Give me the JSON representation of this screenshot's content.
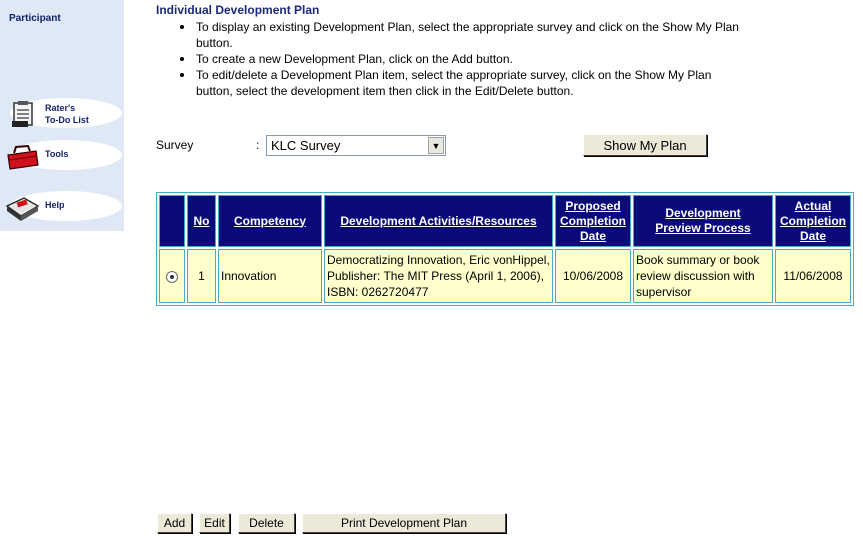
{
  "sidebar": {
    "title": "Participant",
    "items": [
      {
        "label_line1": "Rater's",
        "label_line2": "To-Do List",
        "icon": "rater-todo-icon"
      },
      {
        "label_line1": "Tools",
        "label_line2": "",
        "icon": "toolbox-icon"
      },
      {
        "label_line1": "Help",
        "label_line2": "",
        "icon": "help-icon"
      }
    ]
  },
  "page": {
    "title": "Individual Development Plan",
    "instructions": [
      "To display an existing Development Plan, select the appropriate survey and click on the Show My Plan button.",
      "To create a new Development Plan, click on the Add button.",
      "To edit/delete a Development Plan item, select the appropriate survey, click on the Show My Plan button, select the development item then click in the Edit/Delete button."
    ]
  },
  "survey": {
    "label": "Survey",
    "colon": ":",
    "selected": "KLC Survey",
    "show_button": "Show My Plan"
  },
  "table": {
    "headers": {
      "no": "No",
      "competency": "Competency",
      "activities": "Development Activities/Resources",
      "proposed_l1": "Proposed",
      "proposed_l2": "Completion",
      "proposed_l3": "Date",
      "process_l1": "Development",
      "process_l2": "Preview Process",
      "actual_l1": "Actual",
      "actual_l2": "Completion",
      "actual_l3": "Date"
    },
    "rows": [
      {
        "no": "1",
        "competency": "Innovation",
        "activities": "Democratizing Innovation, Eric vonHippel, Publisher: The MIT Press (April 1, 2006), ISBN: 0262720477",
        "proposed_date": "10/06/2008",
        "process": "Book summary or book review discussion with supervisor",
        "actual_date": "11/06/2008",
        "selected": true
      }
    ]
  },
  "actions": {
    "add": "Add",
    "edit": "Edit",
    "delete": "Delete",
    "print": "Print Development Plan"
  },
  "colors": {
    "header_bg": "#0a0a78",
    "row_bg": "#ffffcc",
    "sidebar_bg": "#dfe9f5",
    "title_color": "#1a2a7a"
  }
}
